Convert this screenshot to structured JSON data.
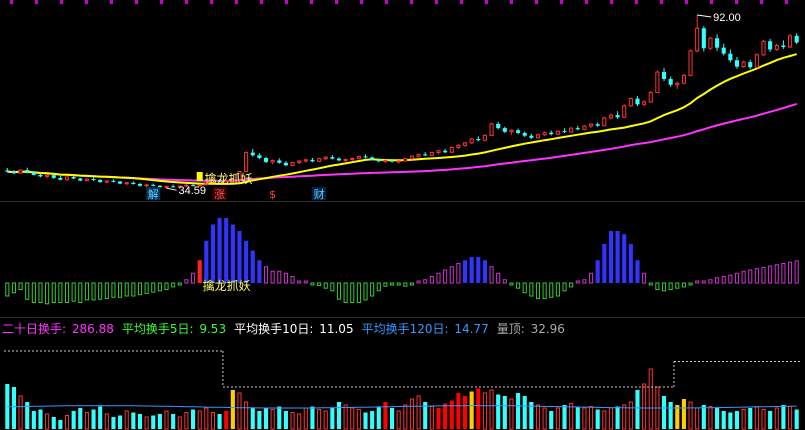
{
  "chart_data": [
    {
      "type": "candlestick",
      "panel": "price",
      "n": 120,
      "candles": [
        [
          40.5,
          41.3,
          39.8,
          40.1
        ],
        [
          40.1,
          40.6,
          39.2,
          39.6
        ],
        [
          39.6,
          40.8,
          39.4,
          40.6
        ],
        [
          40.6,
          41.4,
          39.5,
          39.9
        ],
        [
          39.9,
          40.2,
          38.8,
          39.0
        ],
        [
          39.0,
          39.6,
          38.2,
          38.5
        ],
        [
          38.5,
          39.1,
          37.9,
          38.9
        ],
        [
          38.9,
          39.3,
          37.7,
          38.0
        ],
        [
          38.0,
          38.6,
          37.2,
          37.4
        ],
        [
          37.4,
          38.5,
          37.1,
          38.3
        ],
        [
          38.3,
          38.9,
          37.6,
          37.8
        ],
        [
          37.8,
          38.0,
          36.9,
          37.1
        ],
        [
          37.1,
          37.9,
          36.8,
          37.6
        ],
        [
          37.6,
          38.2,
          37.0,
          37.3
        ],
        [
          37.3,
          37.6,
          36.4,
          36.6
        ],
        [
          36.6,
          37.2,
          36.2,
          37.0
        ],
        [
          37.0,
          37.5,
          36.5,
          36.8
        ],
        [
          36.8,
          37.0,
          35.9,
          36.1
        ],
        [
          36.1,
          36.6,
          35.6,
          36.4
        ],
        [
          36.4,
          36.8,
          35.8,
          36.0
        ],
        [
          36.0,
          36.3,
          35.1,
          35.4
        ],
        [
          35.4,
          35.9,
          34.9,
          35.7
        ],
        [
          35.7,
          36.1,
          35.2,
          35.4
        ],
        [
          35.4,
          35.6,
          34.6,
          34.9
        ],
        [
          34.9,
          35.4,
          34.59,
          35.2
        ],
        [
          35.2,
          35.8,
          34.8,
          35.0
        ],
        [
          35.0,
          35.5,
          34.7,
          35.3
        ],
        [
          35.3,
          35.9,
          35.0,
          35.6
        ],
        [
          35.6,
          36.0,
          35.2,
          35.4
        ],
        [
          35.4,
          35.8,
          35.1,
          35.7
        ],
        [
          35.7,
          36.9,
          35.5,
          36.6
        ],
        [
          36.6,
          37.4,
          36.2,
          37.1
        ],
        [
          37.1,
          37.6,
          36.6,
          36.8
        ],
        [
          36.8,
          37.4,
          36.5,
          37.2
        ],
        [
          37.2,
          37.8,
          36.8,
          37.5
        ],
        [
          37.5,
          40.3,
          37.4,
          40.1
        ],
        [
          40.1,
          46.8,
          39.9,
          46.4
        ],
        [
          46.4,
          47.6,
          45.1,
          45.5
        ],
        [
          45.5,
          46.2,
          44.2,
          44.6
        ],
        [
          44.6,
          45.0,
          42.9,
          43.3
        ],
        [
          43.3,
          44.1,
          42.5,
          43.8
        ],
        [
          43.8,
          44.5,
          42.7,
          43.0
        ],
        [
          43.0,
          43.6,
          41.8,
          42.2
        ],
        [
          42.2,
          43.4,
          41.9,
          43.1
        ],
        [
          43.1,
          43.9,
          42.6,
          43.6
        ],
        [
          43.6,
          44.3,
          43.1,
          44.0
        ],
        [
          44.0,
          44.6,
          43.2,
          43.5
        ],
        [
          43.5,
          44.7,
          43.3,
          44.4
        ],
        [
          44.4,
          45.2,
          43.9,
          44.9
        ],
        [
          44.9,
          45.6,
          44.1,
          44.4
        ],
        [
          44.4,
          44.9,
          43.5,
          43.8
        ],
        [
          43.8,
          44.4,
          43.1,
          44.1
        ],
        [
          44.1,
          44.8,
          43.6,
          44.5
        ],
        [
          44.5,
          45.4,
          44.2,
          45.1
        ],
        [
          45.1,
          45.8,
          44.5,
          44.8
        ],
        [
          44.8,
          45.1,
          43.8,
          44.1
        ],
        [
          44.1,
          44.5,
          43.2,
          43.5
        ],
        [
          43.5,
          44.1,
          42.9,
          43.8
        ],
        [
          43.8,
          44.3,
          43.1,
          43.4
        ],
        [
          43.4,
          43.9,
          42.8,
          43.6
        ],
        [
          43.6,
          44.6,
          43.4,
          44.4
        ],
        [
          44.4,
          45.5,
          44.1,
          45.2
        ],
        [
          45.2,
          46.1,
          44.7,
          45.8
        ],
        [
          45.8,
          46.6,
          45.2,
          45.5
        ],
        [
          45.5,
          46.7,
          45.3,
          46.4
        ],
        [
          46.4,
          47.3,
          45.9,
          47.0
        ],
        [
          47.0,
          47.6,
          46.2,
          46.5
        ],
        [
          46.5,
          48.4,
          46.3,
          48.1
        ],
        [
          48.1,
          49.2,
          47.6,
          48.8
        ],
        [
          48.8,
          49.9,
          48.3,
          49.6
        ],
        [
          49.6,
          51.2,
          49.3,
          50.9
        ],
        [
          50.9,
          51.8,
          50.1,
          50.5
        ],
        [
          50.5,
          52.4,
          50.2,
          52.1
        ],
        [
          52.1,
          56.3,
          51.8,
          55.9
        ],
        [
          55.9,
          56.6,
          54.1,
          54.5
        ],
        [
          54.5,
          55.0,
          52.9,
          53.3
        ],
        [
          53.3,
          54.1,
          52.3,
          53.8
        ],
        [
          53.8,
          54.4,
          52.5,
          52.9
        ],
        [
          52.9,
          53.4,
          51.6,
          52.0
        ],
        [
          52.0,
          52.6,
          50.9,
          51.3
        ],
        [
          51.3,
          52.6,
          51.0,
          52.3
        ],
        [
          52.3,
          53.4,
          51.8,
          53.0
        ],
        [
          53.0,
          53.7,
          52.1,
          52.5
        ],
        [
          52.5,
          53.8,
          52.2,
          53.5
        ],
        [
          53.5,
          54.4,
          52.9,
          53.2
        ],
        [
          53.2,
          54.8,
          53.0,
          54.5
        ],
        [
          54.5,
          55.3,
          53.8,
          54.1
        ],
        [
          54.1,
          55.5,
          53.8,
          55.2
        ],
        [
          55.2,
          56.1,
          54.6,
          55.8
        ],
        [
          55.8,
          56.4,
          54.9,
          55.3
        ],
        [
          55.3,
          58.2,
          55.1,
          57.9
        ],
        [
          57.9,
          59.3,
          57.4,
          58.8
        ],
        [
          58.8,
          60.1,
          57.6,
          58.1
        ],
        [
          58.1,
          62.4,
          57.9,
          61.9
        ],
        [
          61.9,
          64.7,
          61.6,
          64.3
        ],
        [
          64.3,
          65.1,
          61.8,
          62.4
        ],
        [
          62.4,
          63.8,
          61.9,
          63.2
        ],
        [
          63.2,
          66.8,
          62.9,
          66.3
        ],
        [
          66.3,
          73.6,
          66.1,
          73.1
        ],
        [
          73.1,
          74.5,
          70.1,
          70.8
        ],
        [
          70.8,
          71.6,
          68.2,
          68.9
        ],
        [
          68.9,
          69.9,
          67.5,
          69.4
        ],
        [
          69.4,
          72.5,
          69.1,
          72.0
        ],
        [
          72.0,
          80.6,
          71.7,
          80.1
        ],
        [
          80.1,
          92.0,
          79.7,
          87.6
        ],
        [
          87.6,
          88.3,
          79.9,
          81.0
        ],
        [
          81.0,
          84.8,
          80.4,
          84.3
        ],
        [
          84.3,
          85.6,
          80.1,
          81.2
        ],
        [
          81.2,
          82.5,
          78.6,
          79.2
        ],
        [
          79.2,
          80.6,
          76.3,
          77.0
        ],
        [
          77.0,
          78.1,
          74.2,
          74.9
        ],
        [
          74.9,
          76.9,
          74.5,
          76.4
        ],
        [
          76.4,
          77.2,
          74.1,
          74.7
        ],
        [
          74.7,
          79.3,
          74.4,
          78.8
        ],
        [
          78.8,
          83.8,
          78.5,
          83.3
        ],
        [
          83.3,
          84.1,
          79.8,
          80.6
        ],
        [
          80.6,
          82.5,
          80.1,
          81.9
        ],
        [
          81.9,
          83.6,
          80.8,
          81.4
        ],
        [
          81.4,
          85.7,
          81.1,
          85.1
        ],
        [
          85.1,
          86.0,
          82.4,
          82.9
        ]
      ],
      "moving_averages": [
        {
          "color": "#ffff00"
        },
        {
          "color": "#ff33ff"
        }
      ],
      "ylim": [
        32,
        95
      ],
      "annotations": {
        "high_label": "92.00",
        "low_label": "34.59",
        "signal_text": "擒龙抓妖",
        "markers": [
          {
            "text": "解",
            "at": 22,
            "color": "#66ccff",
            "bg": "#003355"
          },
          {
            "text": "涨",
            "at": 32,
            "color": "#ff5555",
            "bg": "#3a0000"
          },
          {
            "text": "$",
            "at": 40,
            "color": "#ff4444",
            "bg": "#000000"
          },
          {
            "text": "财",
            "at": 47,
            "color": "#66ccff",
            "bg": "#002244"
          }
        ]
      }
    },
    {
      "type": "bar",
      "panel": "indicator",
      "values": [
        -2,
        -1.5,
        -1,
        -2.5,
        -3,
        -3,
        -3.2,
        -3,
        -3,
        -3,
        -2.8,
        -3,
        -2.6,
        -2.6,
        -2.5,
        -2.4,
        -2.2,
        -2.2,
        -2,
        -2,
        -1.8,
        -1.6,
        -1.4,
        -1.2,
        -1,
        -0.6,
        -0.3,
        0.5,
        1.5,
        3.5,
        6.5,
        9,
        10,
        10,
        9,
        8,
        6.5,
        5,
        3.5,
        2.5,
        1.8,
        1.8,
        1.5,
        1,
        0.3,
        0.1,
        -0.1,
        -0.4,
        -0.8,
        -1.2,
        -2.5,
        -3,
        -3,
        -3,
        -2.6,
        -2,
        -1.2,
        -0.5,
        -0.3,
        -0.3,
        -0.5,
        -0.3,
        0.3,
        0.5,
        1,
        1.5,
        2,
        2.5,
        3,
        3.5,
        4,
        4,
        3.5,
        2.5,
        1.5,
        0.5,
        -0.2,
        -0.8,
        -1.5,
        -2,
        -2.4,
        -2.4,
        -2.2,
        -2,
        -1.2,
        -0.6,
        0,
        0.5,
        1.5,
        3.5,
        6,
        8,
        8,
        7.5,
        6,
        3.5,
        1.5,
        -0.3,
        -1,
        -1.2,
        -1,
        -0.8,
        -0.6,
        -0.3,
        0,
        0.3,
        0.5,
        0.8,
        1,
        1.2,
        1.5,
        1.8,
        2,
        2.2,
        2.4,
        2.6,
        2.8,
        3,
        3.2,
        3.4
      ],
      "signal_index": 29,
      "signal_text": "擒龙抓妖",
      "colors": {
        "up_strong": "#3333ff",
        "up": "#cc33cc",
        "down": "#33cc33",
        "signal": "#ff2222"
      }
    },
    {
      "type": "bar",
      "panel": "turnover",
      "values": [
        30,
        28,
        22,
        18,
        12,
        13,
        10,
        8,
        6,
        9,
        12,
        14,
        11,
        13,
        15,
        10,
        8,
        9,
        12,
        11,
        10,
        8,
        9,
        10,
        12,
        10,
        8,
        11,
        13,
        12,
        14,
        11,
        10,
        12,
        26,
        24,
        18,
        14,
        12,
        14,
        13,
        15,
        12,
        11,
        10,
        14,
        15,
        13,
        12,
        14,
        18,
        16,
        14,
        13,
        11,
        12,
        15,
        18,
        14,
        12,
        16,
        20,
        22,
        18,
        15,
        14,
        17,
        19,
        24,
        22,
        25,
        27,
        24,
        26,
        23,
        22,
        20,
        24,
        22,
        18,
        16,
        14,
        12,
        14,
        16,
        17,
        15,
        14,
        15,
        13,
        12,
        14,
        15,
        16,
        18,
        26,
        30,
        40,
        28,
        22,
        18,
        16,
        20,
        18,
        14,
        16,
        15,
        14,
        12,
        11,
        12,
        13,
        14,
        15,
        13,
        12,
        14,
        16,
        15,
        13
      ],
      "colors": {
        "cyan": "#33ffff",
        "red_hollow": "#ff3333",
        "red_filled": "#ff0000",
        "yellow": "#ffcc00"
      },
      "filled_red_indices": [
        33,
        57,
        65,
        66,
        67,
        68,
        69,
        70,
        71
      ],
      "yellow_indices": [
        34,
        70,
        101,
        102
      ],
      "dashed_reference_levels": [
        {
          "from": 0,
          "to": 32,
          "level": 52
        },
        {
          "from": 33,
          "to": 100,
          "level": 28
        },
        {
          "from": 101,
          "to": 119,
          "level": 45
        }
      ],
      "legend": [
        {
          "label": "二十日换手:",
          "value": "286.88",
          "color": "#ff33ff",
          "value_color": "#ff33ff"
        },
        {
          "label": "平均换手5日:",
          "value": "9.53",
          "color": "#33ff33",
          "value_color": "#33ff33"
        },
        {
          "label": "平均换手10日:",
          "value": "11.05",
          "color": "#ffffff",
          "value_color": "#ffffff"
        },
        {
          "label": "平均换手120日:",
          "value": "14.77",
          "color": "#3399ff",
          "value_color": "#3399ff"
        },
        {
          "label": "量顶:",
          "value": "32.96",
          "color": "#aaaaaa",
          "value_color": "#aaaaaa"
        }
      ]
    }
  ]
}
